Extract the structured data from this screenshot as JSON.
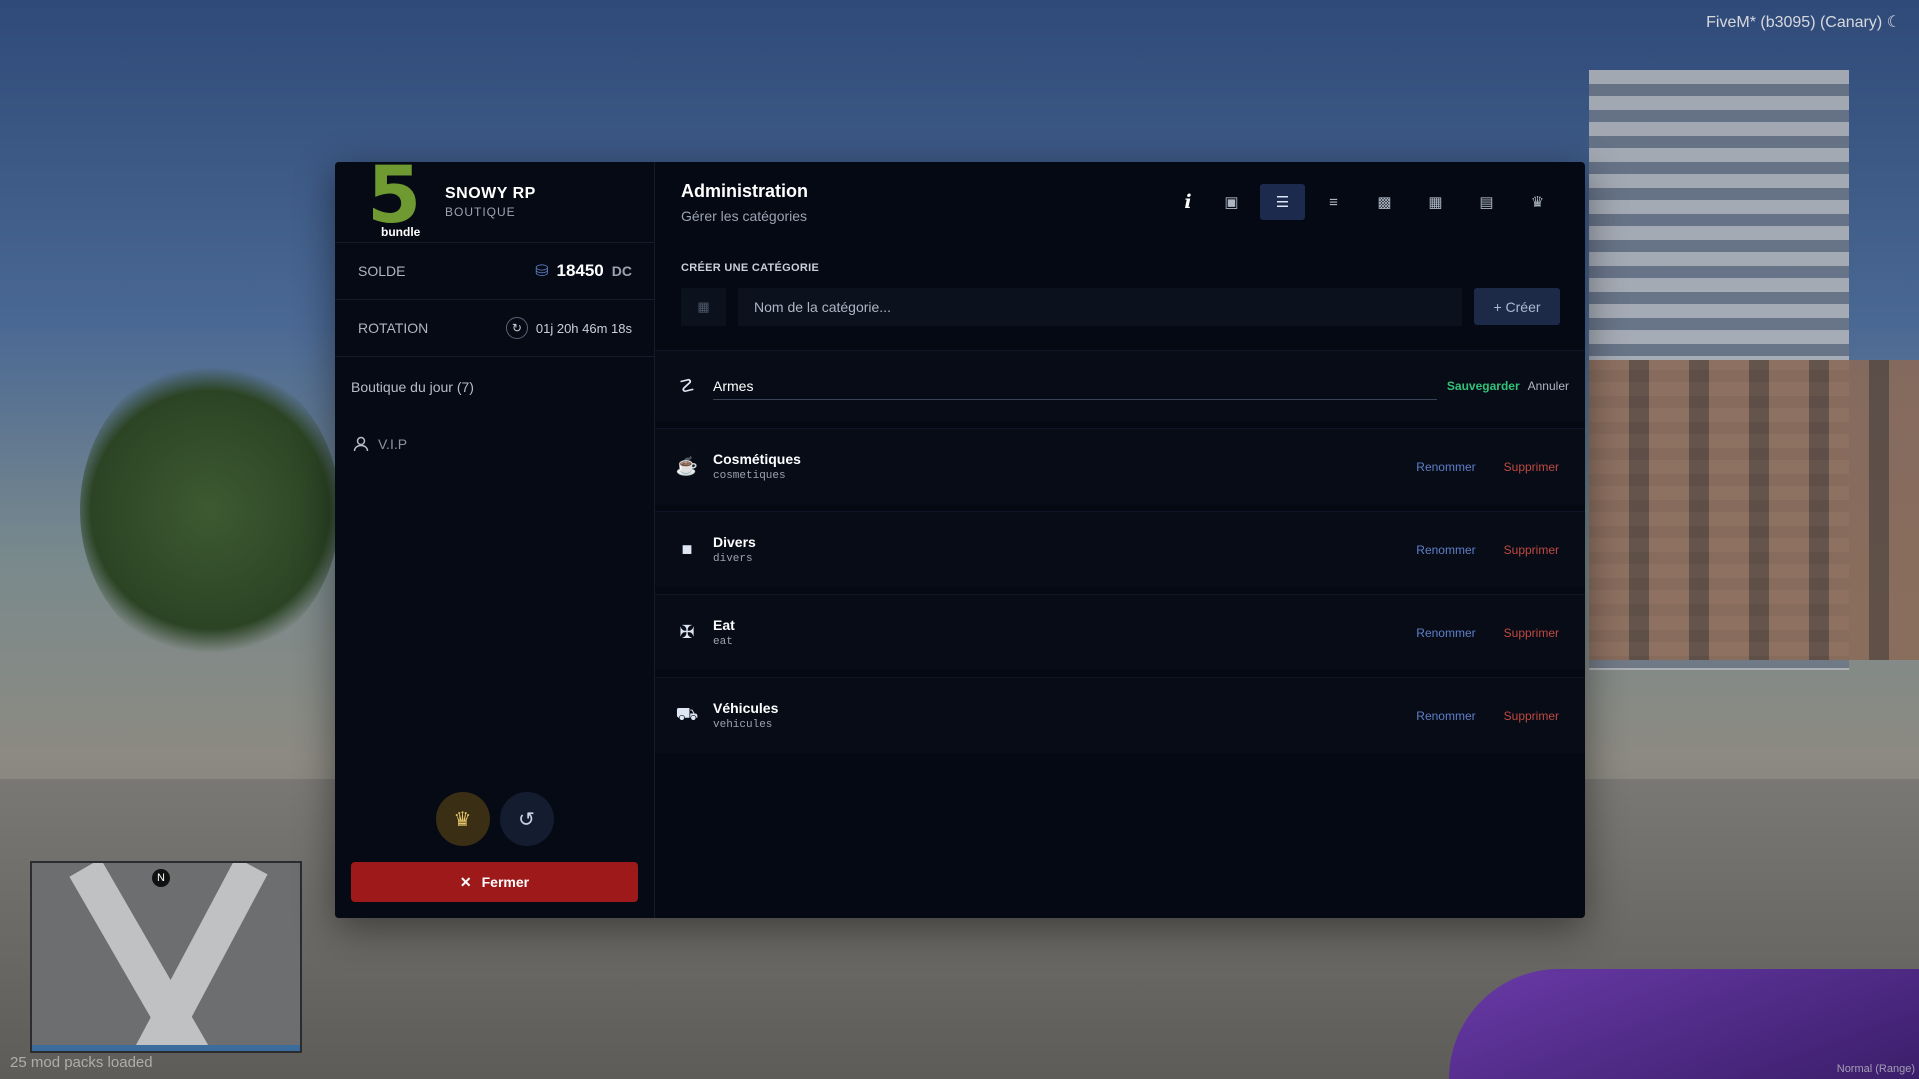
{
  "overlay": {
    "fivem_label": "FiveM* (b3095) (Canary) ☾",
    "modpacks": "25 mod packs loaded",
    "range_label": "Normal (Range)",
    "minimap_north": "N"
  },
  "sidebar": {
    "logo_number": "5",
    "logo_word": "bundle",
    "brand_name": "SNOWY RP",
    "brand_sub": "BOUTIQUE",
    "balance_label": "SOLDE",
    "balance_value": "18450",
    "balance_unit": "DC",
    "rotation_label": "ROTATION",
    "rotation_value": "01j 20h 46m 18s",
    "daily_shop": "Boutique du jour (7)",
    "vip": "V.I.P",
    "close_label": "Fermer"
  },
  "header": {
    "title": "Administration",
    "subtitle": "Gérer les catégories",
    "info_glyph": "i"
  },
  "create": {
    "title": "CRÉER UNE CATÉGORIE",
    "placeholder": "Nom de la catégorie...",
    "button": "+ Créer"
  },
  "editing": {
    "value": "Armes",
    "save": "Sauvegarder",
    "cancel": "Annuler"
  },
  "categories": [
    {
      "name": "Cosmétiques",
      "slug": "cosmetiques",
      "icon": "tshirt-icon"
    },
    {
      "name": "Divers",
      "slug": "divers",
      "icon": "briefcase-icon"
    },
    {
      "name": "Eat",
      "slug": "eat",
      "icon": "utensils-icon"
    },
    {
      "name": "Véhicules",
      "slug": "vehicules",
      "icon": "car-icon"
    }
  ],
  "actions": {
    "rename": "Renommer",
    "delete": "Supprimer"
  },
  "colors": {
    "accent_blue": "#1b2a4d",
    "danger": "#9e1a1a",
    "success": "#34c27a",
    "logo_green": "#6f9a32"
  }
}
